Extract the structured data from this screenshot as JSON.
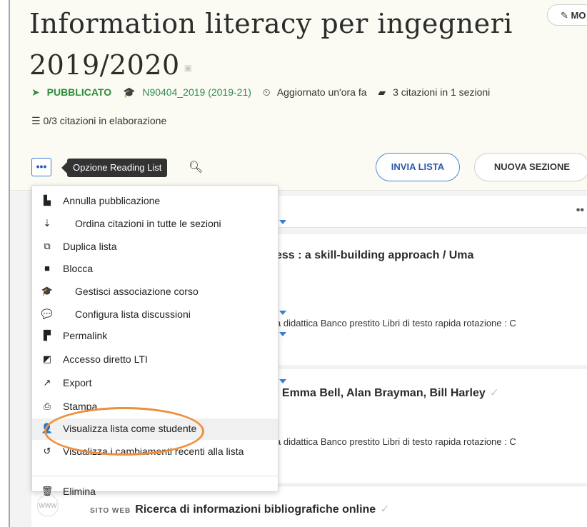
{
  "header": {
    "title_line1": "Information literacy per ingegneri",
    "title_line2": "2019/2020",
    "modify_label": "MO"
  },
  "meta": {
    "status": "PUBBLICATO",
    "course": "N90404_2019 (2019-21)",
    "updated": "Aggiornato un'ora fa",
    "citations": "3 citazioni in 1 sezioni",
    "processing": "0/3 citazioni in elaborazione"
  },
  "toolbar": {
    "dots_label": "•••",
    "tooltip": "Opzione Reading List",
    "send_label": "INVIA LISTA",
    "new_section_label": "NUOVA SEZIONE"
  },
  "menu": {
    "items": [
      {
        "icon": "file-icon",
        "label": "Annulla pubblicazione"
      },
      {
        "icon": "sort-icon",
        "label": "Ordina citazioni in tutte le sezioni",
        "submenu": true
      },
      {
        "icon": "duplicate-icon",
        "label": "Duplica lista"
      },
      {
        "icon": "lock-icon",
        "label": "Blocca"
      },
      {
        "icon": "graduation-cap-icon",
        "label": "Gestisci associazione corso"
      },
      {
        "icon": "comments-icon",
        "label": "Configura lista discussioni",
        "submenu": true
      },
      {
        "icon": "permalink-icon",
        "label": "Permalink",
        "submenu": true
      },
      {
        "icon": "lti-icon",
        "label": "Accesso diretto LTI"
      },
      {
        "icon": "external-link-icon",
        "label": "Export",
        "submenu": true
      },
      {
        "icon": "print-icon",
        "label": "Stampa"
      },
      {
        "icon": "student-icon",
        "label": "Visualizza lista come studente"
      },
      {
        "icon": "history-icon",
        "label": "Visualizza i cambiamenti recenti alla lista"
      },
      {
        "icon": "trash-icon",
        "label": "Elimina"
      }
    ]
  },
  "content": {
    "card1_title": "ess : a skill-building approach / Uma",
    "card1_location": "a didattica Banco prestito Libri di testo rapida rotazione : C",
    "card2_title": "/ Emma Bell, Alan Brayman, Bill Harley",
    "card2_location": "a didattica Banco prestito Libri di testo rapida rotazione : C",
    "card3_type": "SITO WEB",
    "card3_title": "Ricerca di informazioni bibliografiche online",
    "card3_badge": "WWW"
  },
  "colors": {
    "accent": "#3a7bd5",
    "published": "#2e8b3a",
    "highlight": "#ed8f3c"
  }
}
